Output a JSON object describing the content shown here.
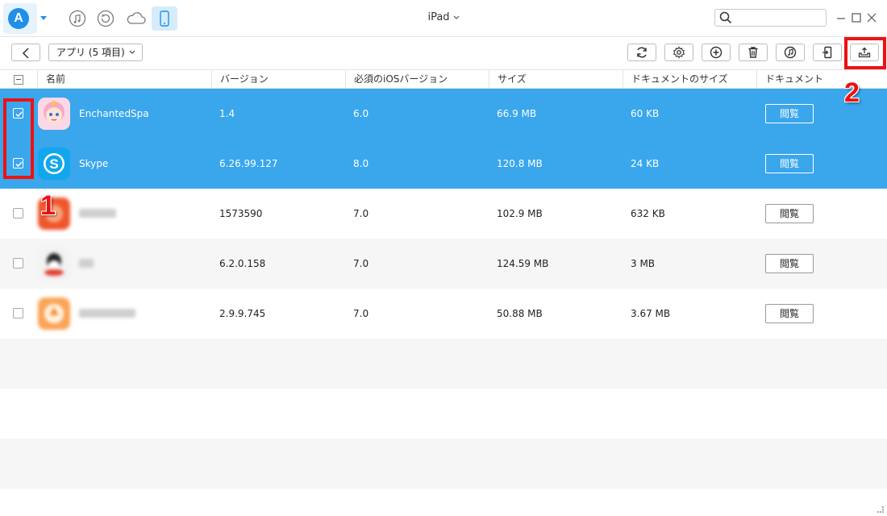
{
  "window": {
    "device_title": "iPad",
    "search": {
      "placeholder": "",
      "value": ""
    }
  },
  "top_icons": [
    "music-icon",
    "restore-icon",
    "cloud-icon",
    "device-icon"
  ],
  "toolbar": {
    "category_label": "アプリ (5 項目)",
    "buttons": [
      "refresh-icon",
      "settings-icon",
      "add-icon",
      "delete-icon",
      "ringtone-icon",
      "export-to-device-icon",
      "export-to-pc-icon"
    ]
  },
  "table": {
    "headers": {
      "name": "名前",
      "version": "バージョン",
      "ios": "必須のiOSバージョン",
      "size": "サイズ",
      "docsize": "ドキュメントのサイズ",
      "docs": "ドキュメント"
    },
    "rows": [
      {
        "name": "EnchantedSpa",
        "version": "1.4",
        "ios": "6.0",
        "size": "66.9 MB",
        "docsize": "60 KB",
        "action": "閲覧",
        "selected": true
      },
      {
        "name": "Skype",
        "version": "6.26.99.127",
        "ios": "8.0",
        "size": "120.8 MB",
        "docsize": "24 KB",
        "action": "閲覧",
        "selected": true
      },
      {
        "name": "",
        "version": "1573590",
        "ios": "7.0",
        "size": "102.9 MB",
        "docsize": "632 KB",
        "action": "閲覧",
        "selected": false
      },
      {
        "name": "",
        "version": "6.2.0.158",
        "ios": "7.0",
        "size": "124.59 MB",
        "docsize": "3 MB",
        "action": "閲覧",
        "selected": false
      },
      {
        "name": "",
        "version": "2.9.9.745",
        "ios": "7.0",
        "size": "50.88 MB",
        "docsize": "3.67 MB",
        "action": "閲覧",
        "selected": false
      }
    ]
  },
  "annotations": {
    "marker1": "1",
    "marker2": "2"
  },
  "colors": {
    "selection": "#3aa6ec",
    "accent": "#1f8fe8",
    "annotation": "#ee1111"
  }
}
